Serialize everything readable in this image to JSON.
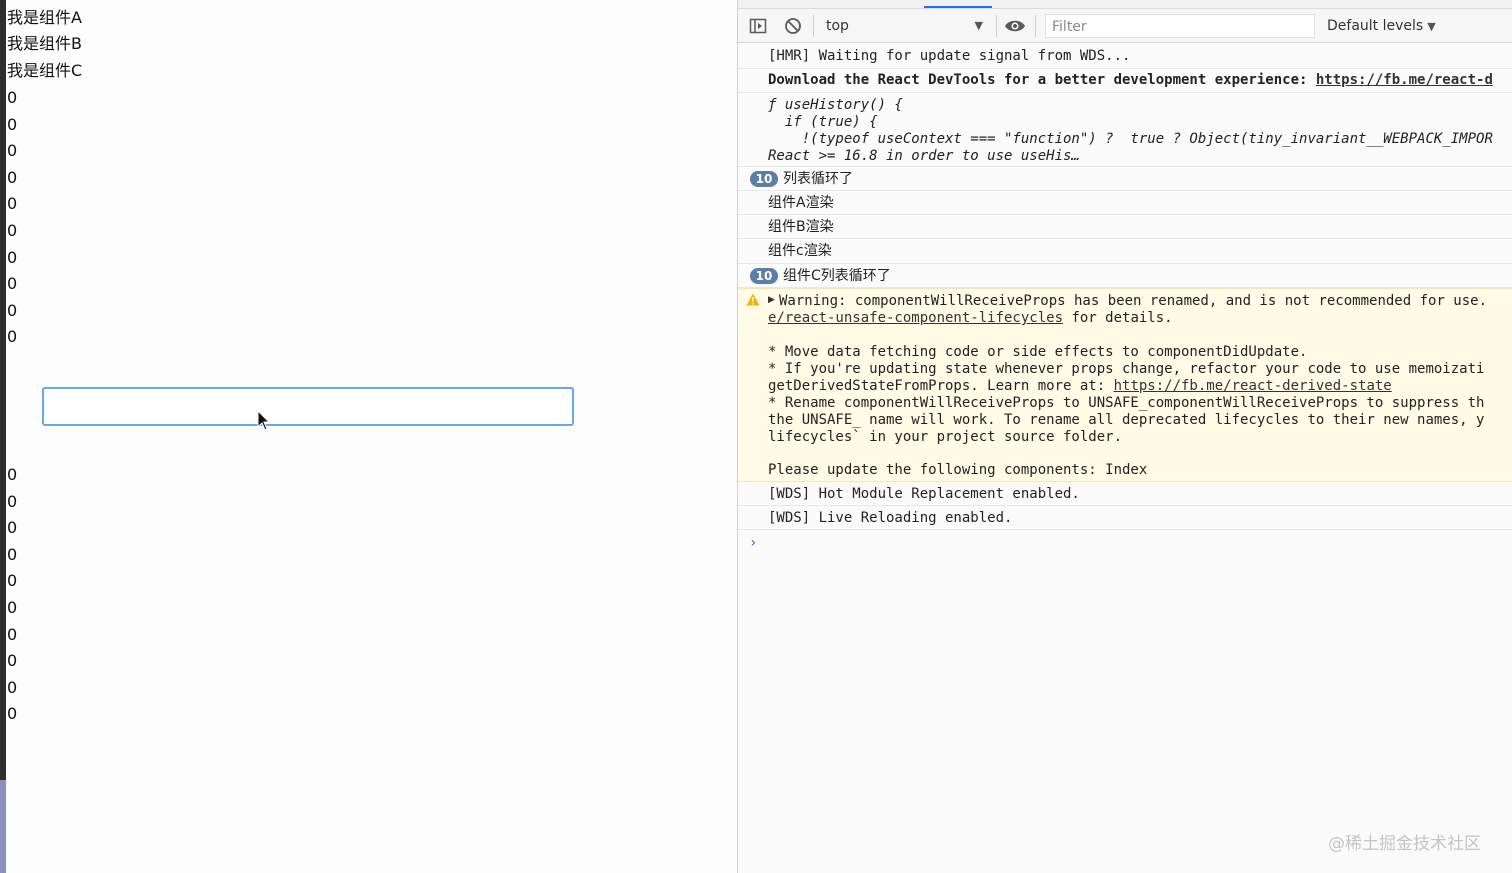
{
  "page": {
    "components": [
      "我是组件A",
      "我是组件B",
      "我是组件C"
    ],
    "zeros_top": [
      "0",
      "0",
      "0",
      "0",
      "0",
      "0",
      "0",
      "0",
      "0",
      "0"
    ],
    "input_value": "",
    "zeros_bottom": [
      "0",
      "0",
      "0",
      "0",
      "0",
      "0",
      "0",
      "0",
      "0",
      "0"
    ]
  },
  "devtools": {
    "context_select": "top",
    "filter_placeholder": "Filter",
    "levels_label": "Default levels",
    "console": {
      "hmr": "[HMR] Waiting for update signal from WDS...",
      "devtools_msg": "Download the React DevTools for a better development experience: ",
      "devtools_link": "https://fb.me/react-d",
      "err_line1": "ƒ useHistory() {",
      "err_line2": "  if (true) {",
      "err_line3": "    !(typeof useContext === \"function\") ?  true ? Object(tiny_invariant__WEBPACK_IMPOR",
      "err_line4": "React >= 16.8 in order to use useHis…",
      "count1": "10",
      "log1": "列表循环了",
      "log2": "组件A渲染",
      "log3": "组件B渲染",
      "log4": "组件c渲染",
      "count2": "10",
      "log5": "组件C列表循环了",
      "warn_line1": "Warning: componentWillReceiveProps has been renamed, and is not recommended for use.",
      "warn_link1": "e/react-unsafe-component-lifecycles",
      "warn_line2_rest": " for details.",
      "warn_line3": "* Move data fetching code or side effects to componentDidUpdate.",
      "warn_line4": "* If you're updating state whenever props change, refactor your code to use memoizati",
      "warn_line5_pre": "getDerivedStateFromProps. Learn more at: ",
      "warn_link2": "https://fb.me/react-derived-state",
      "warn_line6": "* Rename componentWillReceiveProps to UNSAFE_componentWillReceiveProps to suppress th",
      "warn_line7": "the UNSAFE_ name will work. To rename all deprecated lifecycles to their new names, y",
      "warn_line8": "lifecycles` in your project source folder.",
      "warn_line9": "Please update the following components: Index",
      "wds1": "[WDS] Hot Module Replacement enabled.",
      "wds2": "[WDS] Live Reloading enabled.",
      "prompt": "›"
    }
  },
  "watermark": "@稀土掘金技术社区"
}
